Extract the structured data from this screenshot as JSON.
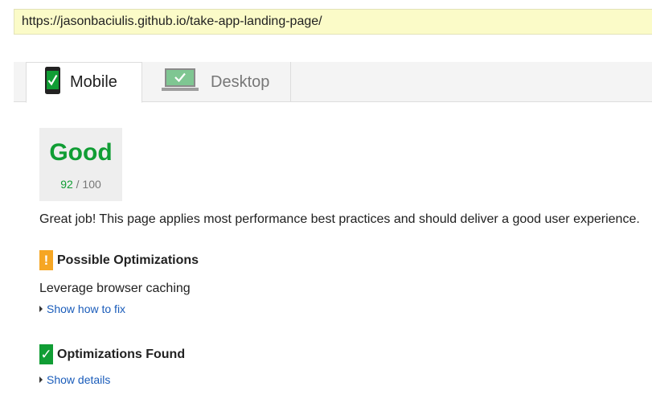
{
  "url_bar": {
    "url": "https://jasonbaciulis.github.io/take-app-landing-page/"
  },
  "tabs": [
    {
      "label": "Mobile",
      "icon": "mobile-check-icon",
      "active": true
    },
    {
      "label": "Desktop",
      "icon": "desktop-check-icon",
      "active": false
    }
  ],
  "score": {
    "rating": "Good",
    "value": "92",
    "max": "/ 100",
    "color": "#109d34"
  },
  "summary": "Great job! This page applies most performance best practices and should deliver a good user experience.",
  "possible_optimizations": {
    "icon": "exclamation-icon",
    "badge_text": "!",
    "title": "Possible Optimizations",
    "items": [
      {
        "label": "Leverage browser caching"
      }
    ],
    "link": "Show how to fix",
    "color": "#f6a623"
  },
  "optimizations_found": {
    "icon": "check-icon",
    "badge_text": "✓",
    "title": "Optimizations Found",
    "link": "Show details",
    "color": "#109d34"
  },
  "colors": {
    "link": "#1a5cba",
    "url_bar_bg": "#fbfbc8"
  }
}
